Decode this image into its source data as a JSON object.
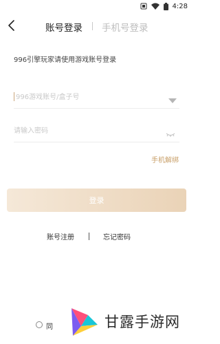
{
  "status_bar": {
    "time": "4:28",
    "icons": [
      "notification-icon",
      "wifi-icon",
      "battery-icon"
    ]
  },
  "header": {
    "back_icon": "chevron-left-icon",
    "tab_account": "账号登录",
    "tab_phone": "手机号登录"
  },
  "subtitle": "996引擎玩家请使用游戏账号登录",
  "account": {
    "value": "",
    "placeholder": "996游戏账号/盒子号",
    "dropdown_icon": "triangle-down-icon"
  },
  "password": {
    "value": "",
    "placeholder": "请输入密码",
    "eye_icon": "eye-closed-icon"
  },
  "unbind_link": "手机解绑",
  "login_button": "登录",
  "links": {
    "register": "账号注册",
    "forgot": "忘记密码"
  },
  "agreement": {
    "text": "同"
  },
  "watermark": {
    "text": "甘露手游网"
  },
  "colors": {
    "accent": "#c9a06a",
    "button_start": "#f5e8d8",
    "button_end": "#ead3b7",
    "inactive_tab": "#bdbdbd"
  }
}
